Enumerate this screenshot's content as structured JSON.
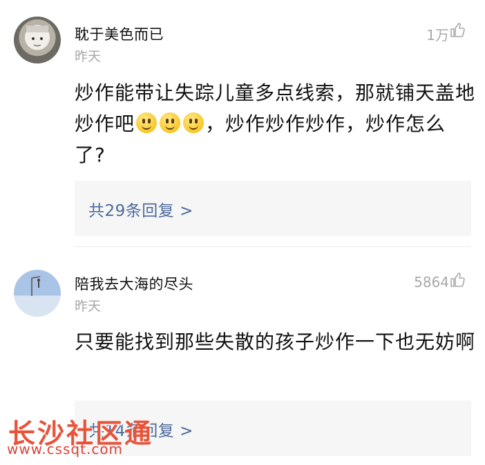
{
  "comments": [
    {
      "username": "耽于美色而已",
      "time": "昨天",
      "likes": "1万",
      "content_before": "炒作能带让失踪儿童多点线索，那就铺天盖地炒作吧",
      "emoji_count": 3,
      "content_after": "，炒作炒作炒作，炒作怎么了?",
      "replies": "共29条回复 >"
    },
    {
      "username": "陪我去大海的尽头",
      "time": "昨天",
      "likes": "5864",
      "content_before": "只要能找到那些失散的孩子炒作一下也无妨啊",
      "replies": "共14条回复 >"
    }
  ],
  "watermark": {
    "text": "长沙社区通",
    "url": "www.cssqt.com"
  },
  "colors": {
    "reply_link": "#4c6a9a",
    "watermark": "#e8533a",
    "secondary_text": "#a7a7a7"
  },
  "icons": {
    "like": "thumb-up-icon",
    "emoji": "smile-emoji"
  }
}
